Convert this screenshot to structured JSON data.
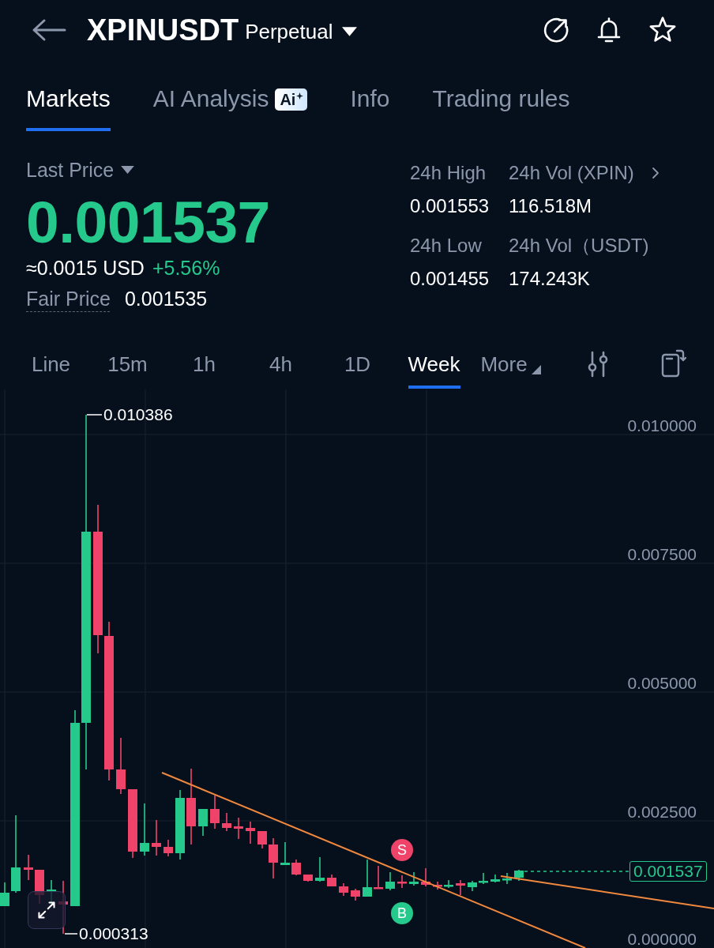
{
  "header": {
    "symbol": "XPINUSDT",
    "contract_type": "Perpetual"
  },
  "tabs": [
    {
      "label": "Markets",
      "selected": true
    },
    {
      "label": "AI Analysis",
      "selected": false,
      "badge": "Ai"
    },
    {
      "label": "Info",
      "selected": false
    },
    {
      "label": "Trading rules",
      "selected": false
    }
  ],
  "last_price": {
    "label": "Last Price",
    "value": "0.001537",
    "usd": "≈0.0015 USD",
    "change": "+5.56%",
    "positive": true
  },
  "fair_price": {
    "label": "Fair Price",
    "value": "0.001535"
  },
  "stats": [
    {
      "label": "24h High",
      "value": "0.001553"
    },
    {
      "label": "24h Vol (XPIN)",
      "value": "116.518M"
    },
    {
      "label": "24h Low",
      "value": "0.001455"
    },
    {
      "label": "24h Vol（USDT)",
      "value": "174.243K"
    }
  ],
  "intervals": [
    {
      "label": "Line",
      "kind": "interval",
      "selected": false
    },
    {
      "label": "15m",
      "kind": "interval",
      "selected": false
    },
    {
      "label": "1h",
      "kind": "interval",
      "selected": false
    },
    {
      "label": "4h",
      "kind": "interval",
      "selected": false
    },
    {
      "label": "1D",
      "kind": "interval",
      "selected": false
    },
    {
      "label": "Week",
      "kind": "interval",
      "selected": true
    },
    {
      "label": "More",
      "kind": "menu",
      "selected": false
    }
  ],
  "chart": {
    "y_axis_labels": [
      "0.010000",
      "0.007500",
      "0.005000",
      "0.002500",
      "0.000000"
    ],
    "high_label": "0.010386",
    "low_label": "0.000313",
    "last_price_tag": "0.001537",
    "markers": [
      {
        "kind": "sell",
        "label": "S"
      },
      {
        "kind": "buy",
        "label": "B"
      }
    ]
  }
}
